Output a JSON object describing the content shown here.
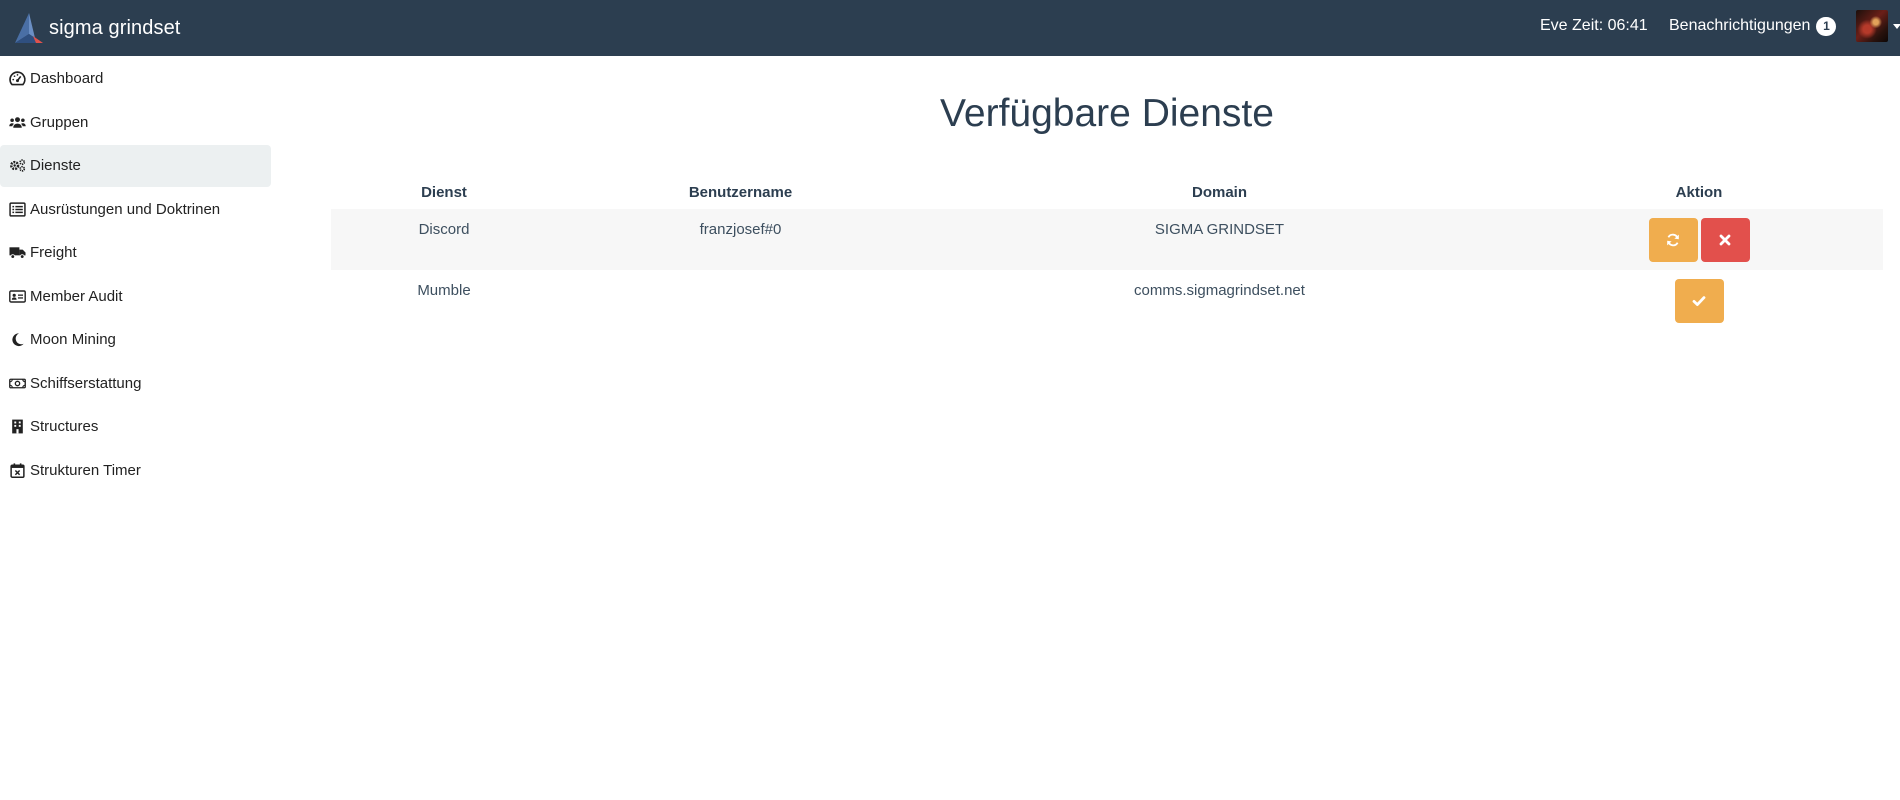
{
  "brand": {
    "name": "sigma grindset",
    "logo_icon": "sigma-logo"
  },
  "header": {
    "eve_time": "Eve Zeit: 06:41",
    "notifications_label": "Benachrichtigungen",
    "notifications_count": "1",
    "avatar_icon": "user-avatar"
  },
  "sidebar": {
    "items": [
      {
        "label": "Dashboard",
        "icon": "tachometer-icon",
        "active": false
      },
      {
        "label": "Gruppen",
        "icon": "users-icon",
        "active": false
      },
      {
        "label": "Dienste",
        "icon": "cogs-icon",
        "active": true
      },
      {
        "label": "Ausrüstungen und Doktrinen",
        "icon": "list-icon",
        "active": false
      },
      {
        "label": "Freight",
        "icon": "truck-icon",
        "active": false
      },
      {
        "label": "Member Audit",
        "icon": "id-card-icon",
        "active": false
      },
      {
        "label": "Moon Mining",
        "icon": "moon-icon",
        "active": false
      },
      {
        "label": "Schiffserstattung",
        "icon": "money-bill-icon",
        "active": false
      },
      {
        "label": "Structures",
        "icon": "building-icon",
        "active": false
      },
      {
        "label": "Strukturen Timer",
        "icon": "calendar-times-icon",
        "active": false
      }
    ]
  },
  "main": {
    "title": "Verfügbare Dienste",
    "table": {
      "headers": [
        "Dienst",
        "Benutzername",
        "Domain",
        "Aktion"
      ],
      "rows": [
        {
          "service": "Discord",
          "username": "franzjosef#0",
          "domain": "SIGMA GRINDSET",
          "actions": [
            "refresh-icon",
            "times-icon"
          ]
        },
        {
          "service": "Mumble",
          "username": "",
          "domain": "comms.sigmagrindset.net",
          "actions": [
            "check-icon"
          ]
        }
      ]
    }
  },
  "colors": {
    "navbar": "#2c3e50",
    "active_item": "#ecf0f1",
    "warning": "#f0ad4e",
    "danger": "#e2504c",
    "stripe": "#f7f7f7"
  }
}
